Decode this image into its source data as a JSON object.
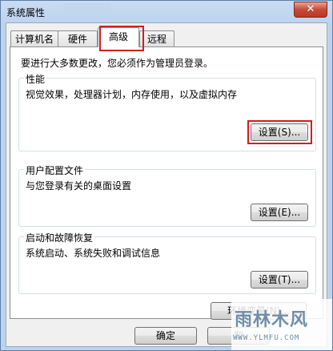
{
  "window": {
    "title": "系统属性",
    "close_label": "✕"
  },
  "tabs": [
    {
      "label": "计算机名"
    },
    {
      "label": "硬件"
    },
    {
      "label": "高级"
    },
    {
      "label": "远程"
    }
  ],
  "advanced": {
    "notice": "要进行大多数更改，您必须作为管理员登录。",
    "performance": {
      "title": "性能",
      "description": "视觉效果，处理器计划，内存使用，以及虚拟内存",
      "button": "设置(S)..."
    },
    "user_profiles": {
      "title": "用户配置文件",
      "description": "与您登录有关的桌面设置",
      "button": "设置(E)..."
    },
    "startup_recovery": {
      "title": "启动和故障恢复",
      "description": "系统启动、系统失败和调试信息",
      "button": "设置(T)..."
    },
    "env_button": "环境变量(N)..."
  },
  "footer": {
    "ok": "确定",
    "cancel": "取"
  },
  "watermark": {
    "text": "雨林木风",
    "url": "WWW.YLMFU.COM"
  },
  "colors": {
    "highlight_box": "#d21d1d",
    "title_bar": "#bcd2ee"
  }
}
